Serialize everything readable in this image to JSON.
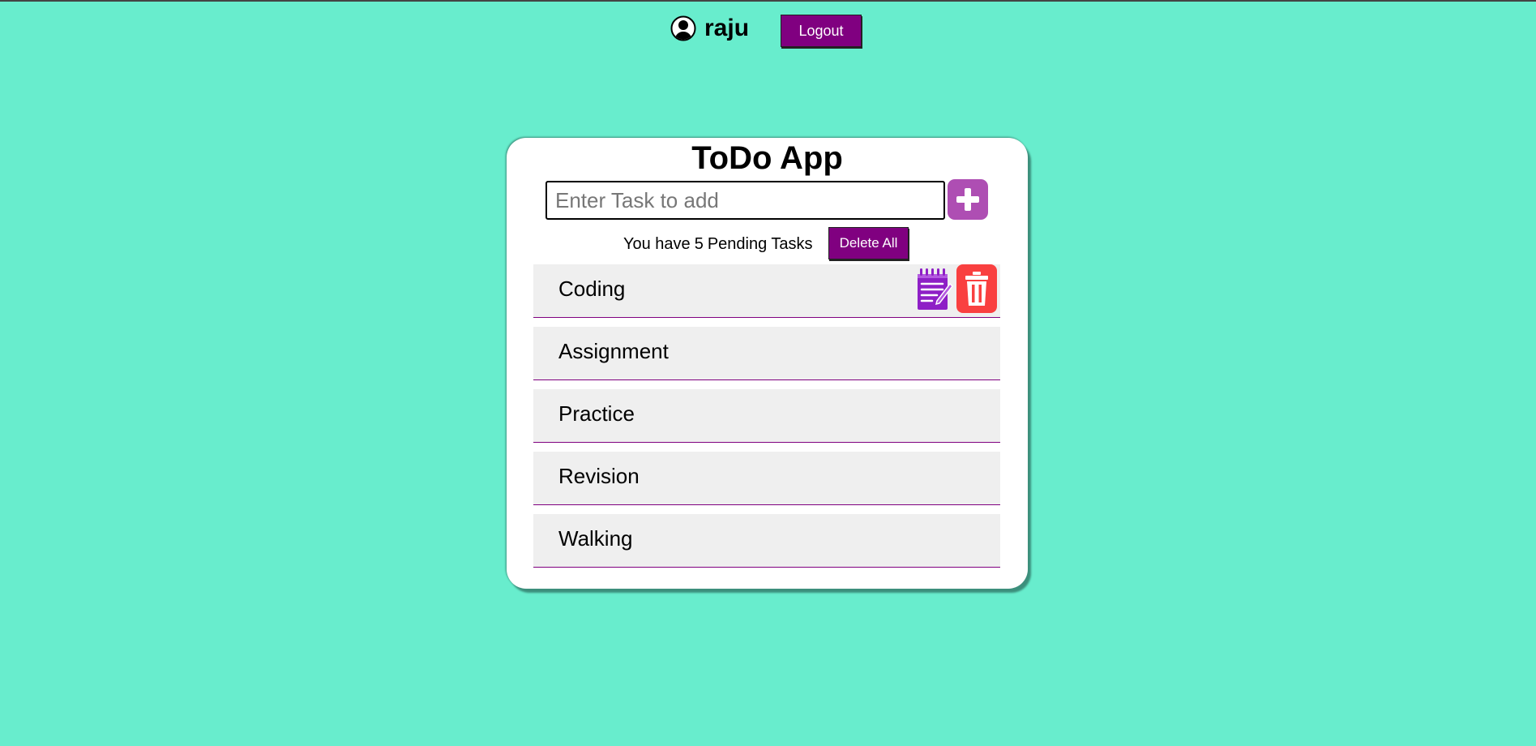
{
  "header": {
    "username": "raju",
    "logout_label": "Logout",
    "avatar_icon": "user-circle-icon"
  },
  "app": {
    "title": "ToDo App",
    "input": {
      "placeholder": "Enter Task to add",
      "value": ""
    },
    "add_icon": "plus-icon",
    "pending": {
      "prefix": "You have",
      "count": "5",
      "suffix": "Pending Tasks"
    },
    "delete_all_label": "Delete All",
    "tasks": [
      {
        "label": "Coding"
      },
      {
        "label": "Assignment"
      },
      {
        "label": "Practice"
      },
      {
        "label": "Revision"
      },
      {
        "label": "Walking"
      }
    ],
    "edit_icon": "notepad-edit-icon",
    "delete_icon": "trash-icon"
  },
  "colors": {
    "background": "#68edcd",
    "accent": "#800080",
    "add_button": "#ae4eb3",
    "delete_button": "#f94040",
    "task_background": "#efefef"
  }
}
